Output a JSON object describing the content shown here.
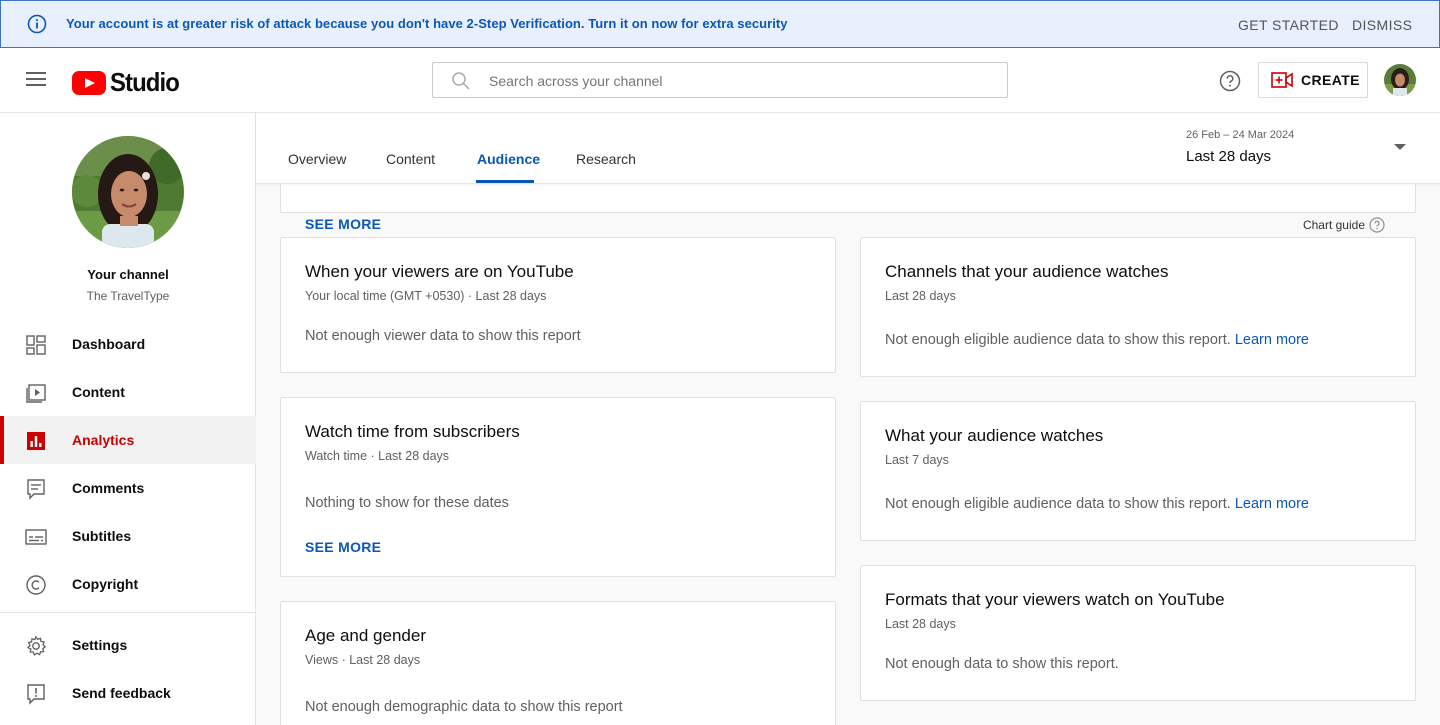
{
  "banner": {
    "message": "Your account is at greater risk of attack because you don't have 2-Step Verification. Turn it on now for extra security",
    "get_started": "GET STARTED",
    "dismiss": "DISMISS"
  },
  "header": {
    "logo_text": "Studio",
    "search_placeholder": "Search across your channel",
    "create_label": "CREATE"
  },
  "sidebar": {
    "channel_title": "Your channel",
    "channel_name": "The TravelType",
    "items": [
      {
        "label": "Dashboard",
        "icon": "dashboard-icon"
      },
      {
        "label": "Content",
        "icon": "content-icon"
      },
      {
        "label": "Analytics",
        "icon": "analytics-icon",
        "active": true
      },
      {
        "label": "Comments",
        "icon": "comments-icon"
      },
      {
        "label": "Subtitles",
        "icon": "subtitles-icon"
      },
      {
        "label": "Copyright",
        "icon": "copyright-icon"
      },
      {
        "label": "Settings",
        "icon": "gear-icon"
      },
      {
        "label": "Send feedback",
        "icon": "feedback-icon"
      }
    ]
  },
  "tabs": {
    "items": [
      "Overview",
      "Content",
      "Audience",
      "Research"
    ],
    "active": "Audience"
  },
  "date": {
    "range": "26 Feb – 24 Mar 2024",
    "label": "Last 28 days"
  },
  "top_card": {
    "see_more": "SEE MORE",
    "chart_guide": "Chart guide"
  },
  "cards": {
    "viewers_time": {
      "title": "When your viewers are on YouTube",
      "sub": "Your local time (GMT +0530) · Last 28 days",
      "body": "Not enough viewer data to show this report"
    },
    "watch_subscribers": {
      "title": "Watch time from subscribers",
      "sub": "Watch time · Last 28 days",
      "body": "Nothing to show for these dates",
      "see_more": "SEE MORE"
    },
    "age_gender": {
      "title": "Age and gender",
      "sub": "Views · Last 28 days",
      "body": "Not enough demographic data to show this report"
    },
    "channels_watch": {
      "title": "Channels that your audience watches",
      "sub": "Last 28 days",
      "body": "Not enough eligible audience data to show this report.",
      "link": "Learn more"
    },
    "audience_watches": {
      "title": "What your audience watches",
      "sub": "Last 7 days",
      "body": "Not enough eligible audience data to show this report.",
      "link": "Learn more"
    },
    "formats": {
      "title": "Formats that your viewers watch on YouTube",
      "sub": "Last 28 days",
      "body": "Not enough data to show this report."
    }
  },
  "colors": {
    "accent_blue": "#0b57b8",
    "brand_red": "#ff0000",
    "active_red": "#cc0000",
    "banner_bg": "#e8f0fe"
  }
}
